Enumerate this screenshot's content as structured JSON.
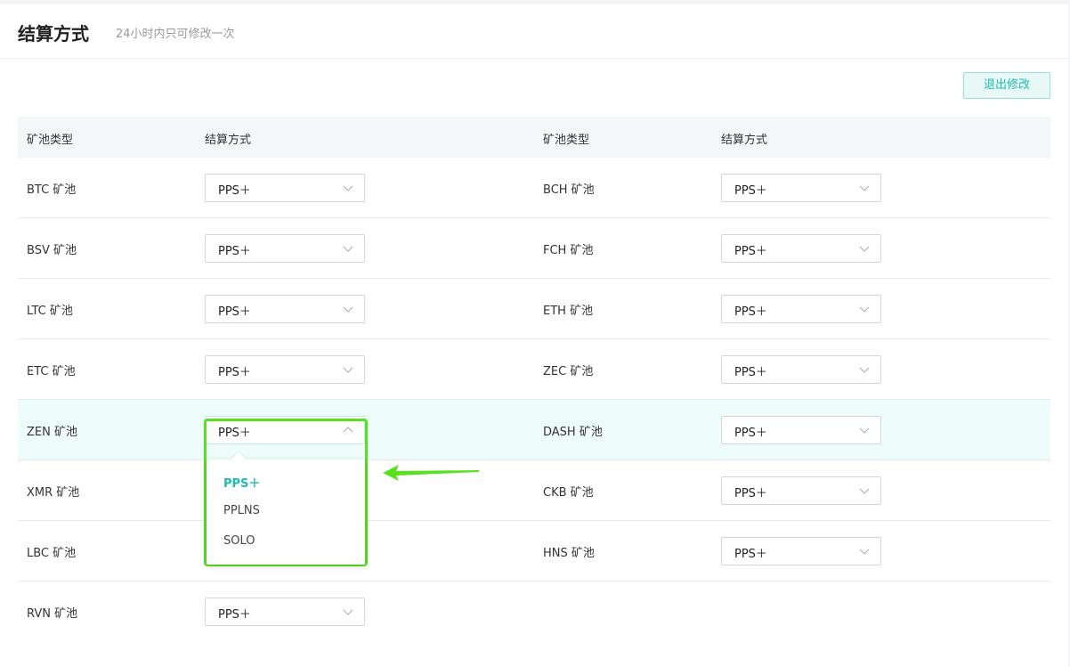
{
  "header": {
    "title": "结算方式",
    "subtitle": "24小时内只可修改一次"
  },
  "actions": {
    "exit_label": "退出修改"
  },
  "table": {
    "headers": {
      "pool_type": "矿池类型",
      "method": "结算方式"
    },
    "rows": [
      {
        "left": {
          "name": "BTC 矿池",
          "value": "PPS＋"
        },
        "right": {
          "name": "BCH 矿池",
          "value": "PPS＋"
        }
      },
      {
        "left": {
          "name": "BSV 矿池",
          "value": "PPS＋"
        },
        "right": {
          "name": "FCH 矿池",
          "value": "PPS＋"
        }
      },
      {
        "left": {
          "name": "LTC 矿池",
          "value": "PPS＋"
        },
        "right": {
          "name": "ETH 矿池",
          "value": "PPS＋"
        }
      },
      {
        "left": {
          "name": "ETC 矿池",
          "value": "PPS＋"
        },
        "right": {
          "name": "ZEC 矿池",
          "value": "PPS＋"
        }
      },
      {
        "left": {
          "name": "ZEN 矿池",
          "value": "PPS＋"
        },
        "right": {
          "name": "DASH 矿池",
          "value": "PPS＋"
        }
      },
      {
        "left": {
          "name": "XMR 矿池",
          "value": ""
        },
        "right": {
          "name": "CKB 矿池",
          "value": "PPS＋"
        }
      },
      {
        "left": {
          "name": "LBC 矿池",
          "value": ""
        },
        "right": {
          "name": "HNS 矿池",
          "value": "PPS＋"
        }
      },
      {
        "left": {
          "name": "RVN 矿池",
          "value": "PPS＋"
        },
        "right": {
          "name": "",
          "value": ""
        }
      }
    ]
  },
  "dropdown": {
    "options": [
      "PPS＋",
      "PPLNS",
      "SOLO"
    ],
    "selected_index": 0
  },
  "colors": {
    "accent": "#1dbcb0",
    "highlight_border": "#57e21f",
    "row_highlight": "#eefcfb"
  },
  "icons": {
    "select_arrow": "chevron-down-icon",
    "open_arrow": "chevron-up-icon",
    "pointer": "arrow-left-icon"
  }
}
